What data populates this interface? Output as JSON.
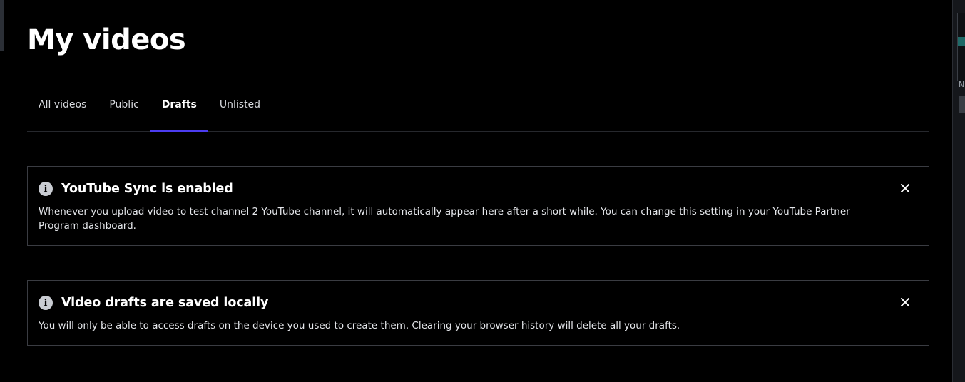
{
  "page": {
    "title": "My videos"
  },
  "tabs": [
    {
      "label": "All videos",
      "active": false
    },
    {
      "label": "Public",
      "active": false
    },
    {
      "label": "Drafts",
      "active": true
    },
    {
      "label": "Unlisted",
      "active": false
    }
  ],
  "notices": [
    {
      "icon": "info-icon",
      "title": "YouTube Sync is enabled",
      "body": "Whenever you upload video to test channel 2 YouTube channel, it will automatically appear here after a short while. You can change this setting in your YouTube Partner Program dashboard.",
      "close_icon": "close-icon"
    },
    {
      "icon": "info-icon",
      "title": "Video drafts are saved locally",
      "body": "You will only be able to access drafts on the device you used to create them. Clearing your browser history will delete all your drafts.",
      "close_icon": "close-icon"
    }
  ],
  "info_icon_glyph": "i",
  "right_panel": {
    "letter": "N"
  },
  "colors": {
    "background": "#000000",
    "accent": "#4b3cf0",
    "border": "#3a3c42",
    "text": "#ffffff"
  }
}
